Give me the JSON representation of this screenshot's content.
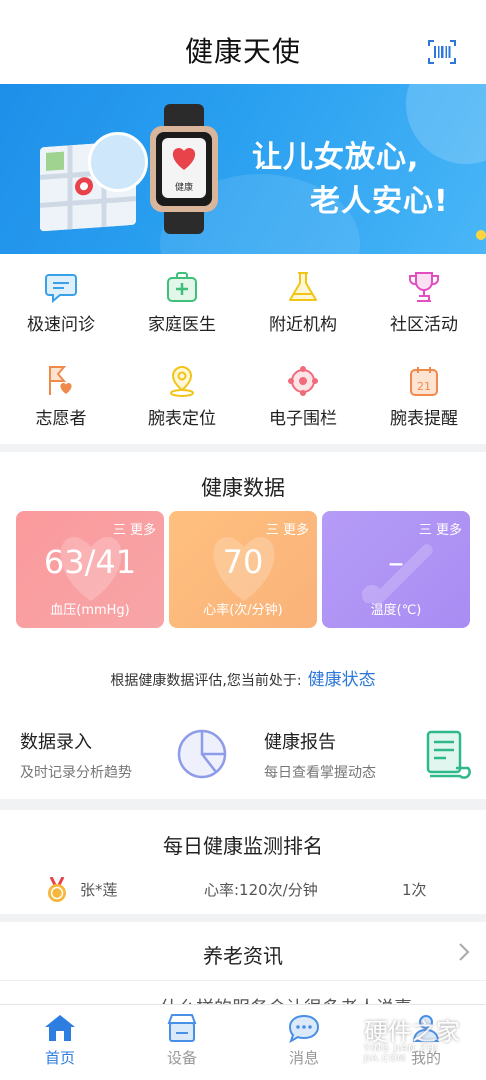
{
  "header": {
    "title": "健康天使",
    "scan_icon": "barcode-scan-icon"
  },
  "banner": {
    "line1": "让儿女放心,",
    "line2": "老人安心!",
    "watch_label": "健康",
    "accent": "#1e8fe9"
  },
  "quick_actions": [
    {
      "label": "极速问诊",
      "icon": "chat-consult-icon",
      "color": "#3aa0e8"
    },
    {
      "label": "家庭医生",
      "icon": "medical-kit-icon",
      "color": "#3ec07a"
    },
    {
      "label": "附近机构",
      "icon": "flask-icon",
      "color": "#f2c418"
    },
    {
      "label": "社区活动",
      "icon": "trophy-icon",
      "color": "#e34fc1"
    },
    {
      "label": "志愿者",
      "icon": "volunteer-icon",
      "color": "#f08a4b"
    },
    {
      "label": "腕表定位",
      "icon": "location-pin-icon",
      "color": "#f2c418"
    },
    {
      "label": "电子围栏",
      "icon": "geofence-icon",
      "color": "#f06b7b"
    },
    {
      "label": "腕表提醒",
      "icon": "calendar-reminder-icon",
      "color": "#f08a4b"
    }
  ],
  "health": {
    "title": "健康数据",
    "cards": [
      {
        "more": "三 更多",
        "value": "63/41",
        "unit": "血压(mmHg)"
      },
      {
        "more": "三 更多",
        "value": "70",
        "unit": "心率(次/分钟)"
      },
      {
        "more": "三 更多",
        "value": "–",
        "unit": "温度(℃)"
      }
    ],
    "status_prefix": "根据健康数据评估,您当前处于:",
    "status_value": "健康状态",
    "entries": [
      {
        "title": "数据录入",
        "subtitle": "及时记录分析趋势",
        "icon": "pie-chart-icon"
      },
      {
        "title": "健康报告",
        "subtitle": "每日查看掌握动态",
        "icon": "report-scroll-icon"
      }
    ]
  },
  "ranking": {
    "title": "每日健康监测排名",
    "rows": [
      {
        "name": "张*莲",
        "rate": "心率:120次/分钟",
        "count": "1次"
      }
    ]
  },
  "news": {
    "title": "养老资讯",
    "peek": "什么样的服务会让很多老人说喜"
  },
  "tabbar": [
    {
      "label": "首页",
      "icon": "home-icon",
      "active": true
    },
    {
      "label": "设备",
      "icon": "device-store-icon",
      "active": false
    },
    {
      "label": "消息",
      "icon": "message-bubble-icon",
      "active": false
    },
    {
      "label": "我的",
      "icon": "profile-icon",
      "active": false
    }
  ],
  "watermark": {
    "text": "硬件之家",
    "sub": "YING JIAN ZHI JIA.COM"
  }
}
